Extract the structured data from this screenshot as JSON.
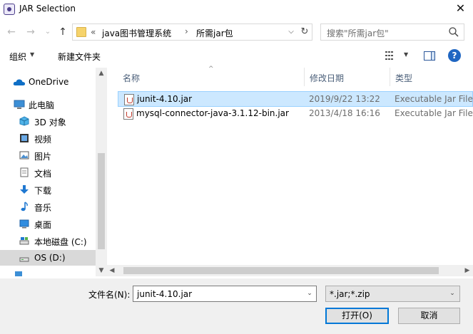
{
  "window": {
    "title": "JAR Selection",
    "close_glyph": "✕",
    "app_icon": "eclipse-app-icon"
  },
  "nav": {
    "back_glyph": "←",
    "forward_glyph": "→",
    "recent_glyph": "⌄",
    "up_glyph": "↑",
    "address": {
      "overflow": "«",
      "crumbs": [
        "java图书管理系统",
        "所需jar包"
      ],
      "separator": "›",
      "dropdown_glyph": "⌵",
      "refresh_glyph": "↻"
    },
    "search": {
      "placeholder": "搜索\"所需jar包\""
    }
  },
  "toolbar": {
    "organize": "组织",
    "organize_arrow": "▼",
    "new_folder": "新建文件夹",
    "view_arrow": "▼",
    "help_glyph": "?"
  },
  "sidebar": {
    "items": [
      {
        "label": "OneDrive",
        "icon": "onedrive-icon"
      },
      {
        "label": "此电脑",
        "icon": "computer-icon"
      },
      {
        "label": "3D 对象",
        "icon": "3d-objects-icon"
      },
      {
        "label": "视频",
        "icon": "video-icon"
      },
      {
        "label": "图片",
        "icon": "pictures-icon"
      },
      {
        "label": "文档",
        "icon": "documents-icon"
      },
      {
        "label": "下载",
        "icon": "download-icon"
      },
      {
        "label": "音乐",
        "icon": "music-icon"
      },
      {
        "label": "桌面",
        "icon": "desktop-icon"
      },
      {
        "label": "本地磁盘 (C:)",
        "icon": "drive-icon"
      },
      {
        "label": "OS (D:)",
        "icon": "drive-icon",
        "selected": true
      }
    ]
  },
  "filelist": {
    "columns": [
      "名称",
      "修改日期",
      "类型"
    ],
    "sort_glyph": "^",
    "rows": [
      {
        "name": "junit-4.10.jar",
        "modified": "2019/9/22 13:22",
        "type": "Executable Jar File",
        "selected": true
      },
      {
        "name": "mysql-connector-java-3.1.12-bin.jar",
        "modified": "2013/4/18 16:16",
        "type": "Executable Jar File",
        "selected": false
      }
    ]
  },
  "footer": {
    "filename_label": "文件名(N):",
    "filename_value": "junit-4.10.jar",
    "filetype_value": "*.jar;*.zip",
    "open_button": "打开(O)",
    "cancel_button": "取消",
    "dropdown_glyph": "⌄"
  },
  "colors": {
    "selection": "#cce8ff",
    "selection_border": "#99d1ff",
    "accent": "#0078d7",
    "header_text": "#4c607a"
  }
}
